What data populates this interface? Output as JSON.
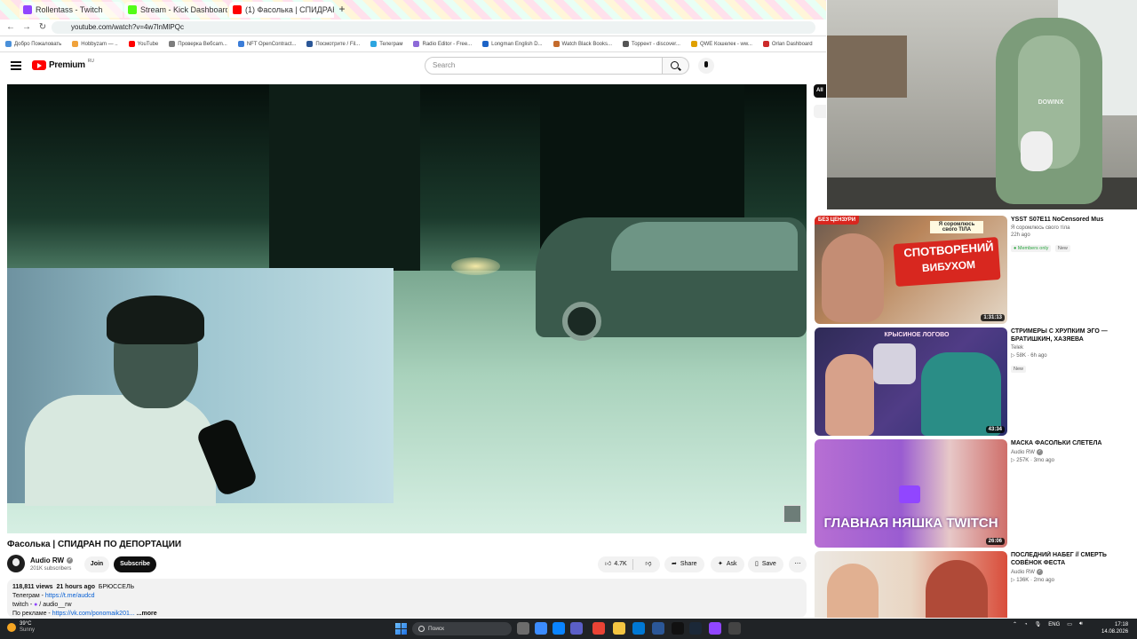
{
  "browser": {
    "tabs": [
      {
        "label": "Rollentass - Twitch",
        "icon_color": "#9146ff",
        "active": false
      },
      {
        "label": "Stream - Kick Dashboard",
        "icon_color": "#53fc18",
        "active": false
      },
      {
        "label": "(1) Фасолька | СПИДРАН ПО ...",
        "icon_color": "#ff0000",
        "active": true
      }
    ],
    "url": "youtube.com/watch?v=4w7lnMlPQc",
    "bookmarks": [
      "Добро Пожаловать",
      "Hobbyzam — ..",
      "YouTube",
      "Проверка Вебcam...",
      "NFT OpenContract...",
      "Посмотрите / Fil...",
      "Телеграм",
      "Radio Editor - Free...",
      "Longman English D...",
      "Watch Black Books...",
      "Торрент - discover...",
      "QWE Кошелек - ww...",
      "Orlan Dashboard"
    ]
  },
  "youtube": {
    "brand": "Premium",
    "region": "RU",
    "search_placeholder": "Search"
  },
  "video": {
    "title": "Фасолька | СПИДРАН ПО ДЕПОРТАЦИИ",
    "channel": "Audio RW",
    "subscribers": "201K subscribers",
    "join_label": "Join",
    "subscribe_label": "Subscribe",
    "likes": "4.7K",
    "share_label": "Share",
    "ask_label": "Ask",
    "save_label": "Save"
  },
  "description": {
    "views": "118,811 views",
    "age": "21 hours ago",
    "tag": "БРЮССЕЛЬ",
    "line1_label": "Телеграм - ",
    "line1_link": "https://t.me/audcd",
    "line2_label": "twitch - ",
    "line2_text": " / audio__rw",
    "line3_label": "По рекламе - ",
    "line3_link": "https://vk.com/ponomaik201...",
    "more_label": "...more"
  },
  "sidebar": {
    "chip_label": "All"
  },
  "webcam": {
    "chair_brand": "DOWINX"
  },
  "recommendations": [
    {
      "title": "YSST S07E11 NoCensored Mus",
      "channel": "Я соромлюсь свого тіла",
      "meta": "22h ago",
      "badges": [
        "Members only",
        "New"
      ],
      "duration": "1:31:13",
      "thumb_censor": "БЕЗ ЦЕНЗУРИ",
      "thumb_top": "Я соромлюсь свого ТІЛА",
      "thumb_line1": "СПОТВОРЕНИЙ",
      "thumb_line2": "ВИБУХОМ"
    },
    {
      "title": "СТРИМЕРЫ С ХРУПКИМ ЭГО — БРАТИШКИН, ХАЗЯЕВА",
      "channel": "Telek",
      "meta": "▷ 58K · 6h ago",
      "badges": [
        "New"
      ],
      "duration": "43:34",
      "thumb_sign": "КРЫСИНОЕ ЛОГОВО"
    },
    {
      "title": "МАСКА ФАСОЛЬКИ СЛЕТЕЛА",
      "channel": "Audio RW",
      "meta": "▷ 257K · 3mo ago",
      "badges": [],
      "duration": "26:06",
      "thumb_text": "ГЛАВНАЯ НЯШКА TWITCH"
    },
    {
      "title": "ПОСЛЕДНИЙ НАБЕГ // СМЕРТЬ СОВЁНОК ФЕСТА",
      "channel": "Audio RW",
      "meta": "▷ 136K · 2mo ago",
      "badges": [],
      "duration": ""
    }
  ],
  "taskbar": {
    "weather_temp": "39°C",
    "weather_desc": "Sunny",
    "search_label": "Поиск",
    "lang": "ENG",
    "time": "17:18",
    "date": "14.08.2026"
  },
  "colors": {
    "accent": "#ff0000",
    "link": "#065fd4",
    "taskbar": "#202326"
  }
}
